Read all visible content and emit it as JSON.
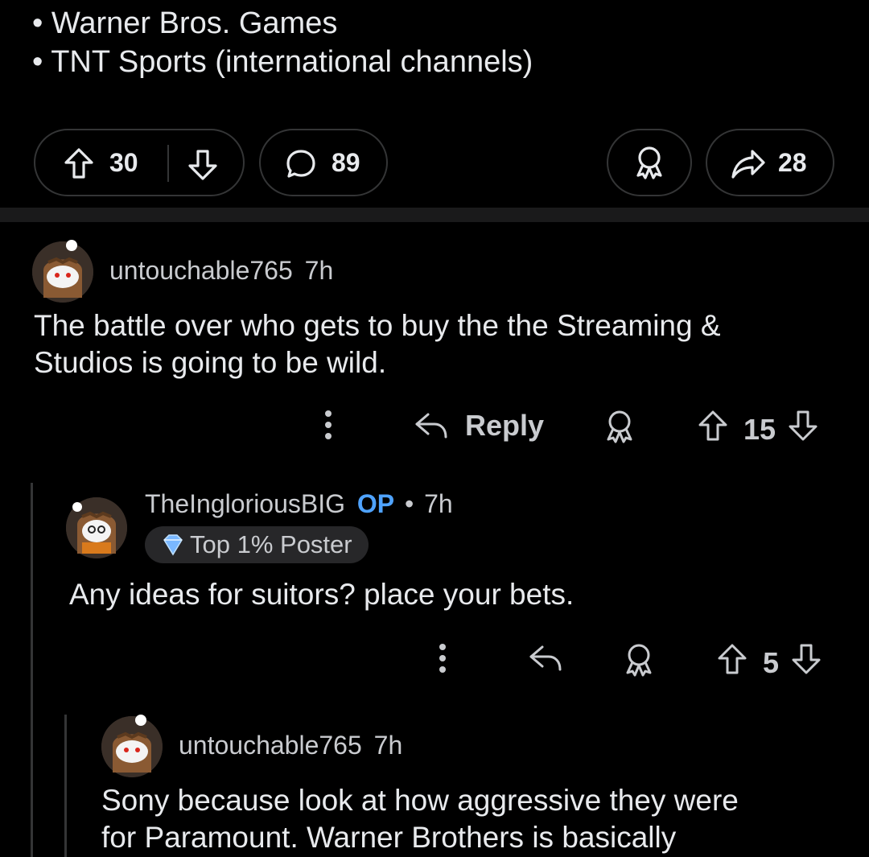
{
  "post": {
    "bullets": [
      "Warner Bros. Games",
      "TNT Sports (international channels)"
    ],
    "bullet_char": "•",
    "vote_count": "30",
    "comment_count": "89",
    "share_count": "28"
  },
  "comments": [
    {
      "username": "untouchable765",
      "time": "7h",
      "text_lines": [
        "The battle over who gets to buy the the Streaming &",
        "Studios is going to be wild."
      ],
      "reply_label": "Reply",
      "vote_count": "15"
    },
    {
      "username": "TheIngloriousBIG",
      "op_badge": "OP",
      "separator": "•",
      "time": "7h",
      "flair": "Top 1% Poster",
      "text_lines": [
        "Any ideas for suitors? place your bets."
      ],
      "vote_count": "5"
    },
    {
      "username": "untouchable765",
      "time": "7h",
      "text_lines": [
        "Sony because look at how aggressive they were",
        "for Paramount. Warner Brothers is basically"
      ]
    }
  ],
  "colors": {
    "background": "#000000",
    "text": "#e8eaed",
    "muted": "#c9cbcf",
    "op_blue": "#4fa3ff",
    "border": "#343536"
  },
  "icons": [
    "upvote-icon",
    "downvote-icon",
    "comment-icon",
    "award-icon",
    "share-icon",
    "reply-icon",
    "more-icon",
    "flair-diamond-icon"
  ]
}
